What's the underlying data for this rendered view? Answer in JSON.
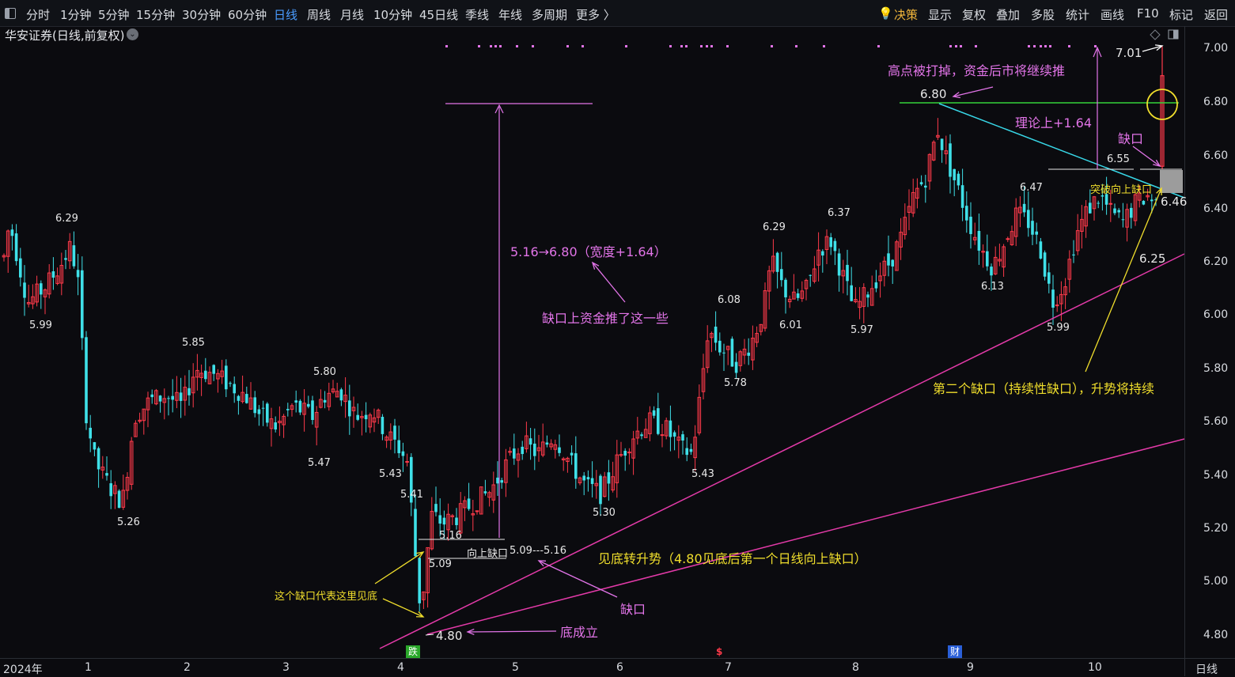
{
  "toolbar": {
    "periods": [
      "分时",
      "1分钟",
      "5分钟",
      "15分钟",
      "30分钟",
      "60分钟",
      "日线",
      "周线",
      "月线",
      "10分钟",
      "45日线",
      "季线",
      "年线",
      "多周期",
      "更多 〉"
    ],
    "active_period": "日线",
    "right": [
      "决策",
      "显示",
      "复权",
      "叠加",
      "多股",
      "统计",
      "画线",
      "F10",
      "标记",
      "返回"
    ]
  },
  "chart_title": "华安证券(日线,前复权)",
  "chevron": "⌄",
  "y_axis": [
    "7.00",
    "6.80",
    "6.60",
    "6.40",
    "6.20",
    "6.00",
    "5.80",
    "5.60",
    "5.40",
    "5.20",
    "5.00",
    "4.80"
  ],
  "x_axis": [
    "2024年",
    "1",
    "2",
    "3",
    "4",
    "5",
    "6",
    "7",
    "8",
    "9",
    "10"
  ],
  "period_label": "日线",
  "badges": {
    "die": "跌",
    "dollar": "$",
    "cai": "财"
  },
  "price_labels": [
    "6.29",
    "5.99",
    "5.85",
    "5.26",
    "5.80",
    "5.47",
    "5.43",
    "5.41",
    "5.09",
    "5.16",
    "4.80",
    "6.08",
    "5.78",
    "5.43",
    "5.30",
    "6.29",
    "6.01",
    "6.37",
    "5.97",
    "6.80",
    "6.13",
    "6.47",
    "5.99",
    "6.55",
    "6.46",
    "6.25",
    "7.01"
  ],
  "annotations": {
    "gap_range": "5.16→6.80（宽度+1.64）",
    "gap_push": "缺口上资金推了这一些",
    "high_broken": "高点被打掉，资金后市将继续推",
    "theory": "理论上+1.64",
    "gap_small": "缺口",
    "breakout_gap": "突破向上缺口",
    "second_gap": "第二个缺口（持续性缺口），升势将持续",
    "trend_turn": "见底转升势（4.80见底后第一个日线向上缺口）",
    "gap_bottom": "缺口",
    "bottom_formed": "底成立",
    "bottom_here": "这个缺口代表这里见底",
    "up_gap": "向上缺口",
    "up_gap_range": "5.09---5.16"
  },
  "chart_data": {
    "type": "candlestick",
    "title": "华安证券(日线,前复权)",
    "ylim": [
      4.75,
      7.07
    ],
    "ticks_y": [
      4.8,
      5.0,
      5.2,
      5.4,
      5.6,
      5.8,
      6.0,
      6.2,
      6.4,
      6.6,
      6.8,
      7.0
    ],
    "key_points": [
      {
        "label": "6.29",
        "value": 6.29
      },
      {
        "label": "5.99",
        "value": 5.99
      },
      {
        "label": "5.85",
        "value": 5.85
      },
      {
        "label": "5.26",
        "value": 5.26
      },
      {
        "label": "5.80",
        "value": 5.8
      },
      {
        "label": "5.47",
        "value": 5.47
      },
      {
        "label": "5.43",
        "value": 5.43
      },
      {
        "label": "5.41",
        "value": 5.41
      },
      {
        "label": "5.09",
        "value": 5.09
      },
      {
        "label": "5.16",
        "value": 5.16
      },
      {
        "label": "4.80",
        "value": 4.8
      },
      {
        "label": "6.08",
        "value": 6.08
      },
      {
        "label": "5.78",
        "value": 5.78
      },
      {
        "label": "5.43",
        "value": 5.43
      },
      {
        "label": "5.30",
        "value": 5.3
      },
      {
        "label": "6.29",
        "value": 6.29
      },
      {
        "label": "6.01",
        "value": 6.01
      },
      {
        "label": "6.37",
        "value": 6.37
      },
      {
        "label": "5.97",
        "value": 5.97
      },
      {
        "label": "6.80",
        "value": 6.8
      },
      {
        "label": "6.13",
        "value": 6.13
      },
      {
        "label": "6.47",
        "value": 6.47
      },
      {
        "label": "5.99",
        "value": 5.99
      },
      {
        "label": "6.55",
        "value": 6.55
      },
      {
        "label": "6.46",
        "value": 6.46
      },
      {
        "label": "6.25",
        "value": 6.25
      },
      {
        "label": "7.01",
        "value": 7.01
      }
    ],
    "colors": {
      "up": "#ff3a4a",
      "down": "#3fe0e8",
      "pink": "#e33aa8",
      "violet": "#e274e8",
      "yellow": "#f0de2c",
      "green": "#35d33a",
      "cyan": "#38d8e8"
    }
  }
}
